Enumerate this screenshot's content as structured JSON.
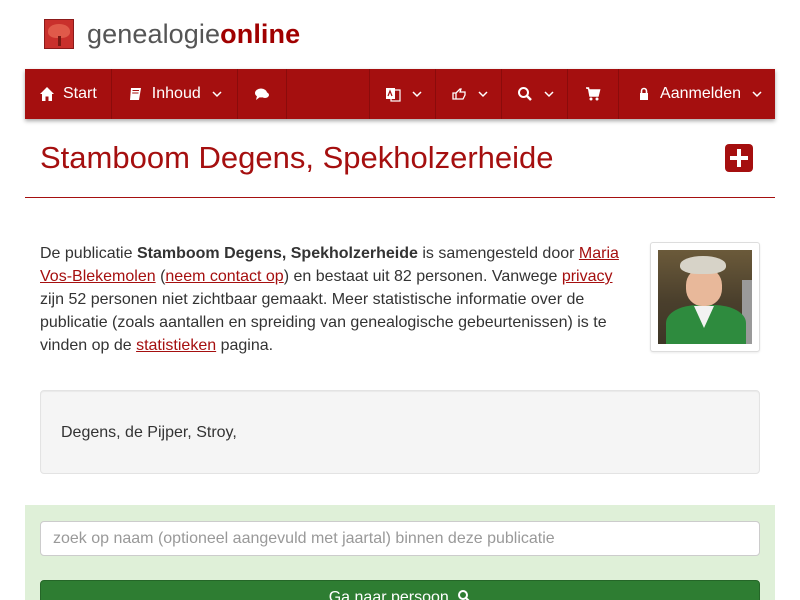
{
  "brand": {
    "name_part1": "genealogie",
    "name_part2": "online"
  },
  "nav": {
    "start_label": "Start",
    "inhoud_label": "Inhoud",
    "login_label": "Aanmelden"
  },
  "page": {
    "title": "Stamboom Degens, Spekholzerheide"
  },
  "intro": {
    "t1": "De publicatie ",
    "pub_name": "Stamboom Degens, Spekholzerheide",
    "t2": " is samengesteld door ",
    "author": "Maria Vos-Blekemolen",
    "t3": " (",
    "contact": "neem contact op",
    "t4": ") en bestaat uit 82 personen. Vanwege ",
    "privacy": "privacy",
    "t5": " zijn 52 personen niet zichtbaar gemaakt. Meer statistische informatie over de publicatie (zoals aantallen en spreiding van genealogische gebeurtenissen) is te vinden op de ",
    "stats": "statistieken",
    "t6": " pagina."
  },
  "surnames": "Degens, de Pijper, Stroy,",
  "search": {
    "placeholder": "zoek op naam (optioneel aangevuld met jaartal) binnen deze publicatie",
    "button_label": "Ga naar persoon"
  },
  "colors": {
    "brand_red": "#a50f0f",
    "panel_green": "#dff0d8",
    "button_green": "#2e7d32"
  },
  "icons": [
    "home-icon",
    "book-icon",
    "comments-icon",
    "language-icon",
    "hand-pointer-icon",
    "search-icon",
    "shopping-cart-icon",
    "lock-icon",
    "chevron-down-icon",
    "plus-square-icon"
  ]
}
